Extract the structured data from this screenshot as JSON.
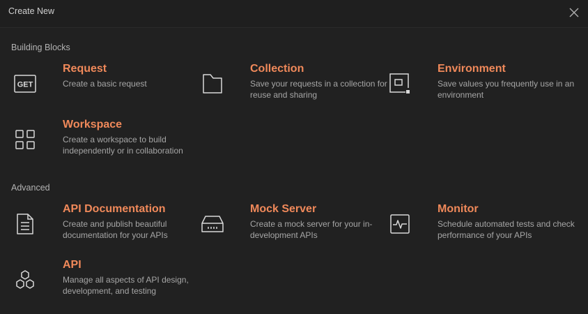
{
  "header": {
    "title": "Create New",
    "close_icon": "close-icon"
  },
  "sections": {
    "building_blocks": {
      "title": "Building Blocks",
      "items": [
        {
          "title": "Request",
          "description": "Create a basic request",
          "icon": "get-request-icon"
        },
        {
          "title": "Collection",
          "description": "Save your requests in a collection for reuse and sharing",
          "icon": "folder-icon"
        },
        {
          "title": "Environment",
          "description": "Save values you frequently use in an environment",
          "icon": "environment-icon"
        },
        {
          "title": "Workspace",
          "description": "Create a workspace to build independently or in collaboration",
          "icon": "grid-icon"
        }
      ]
    },
    "advanced": {
      "title": "Advanced",
      "items": [
        {
          "title": "API Documentation",
          "description": "Create and publish beautiful documentation for your APIs",
          "icon": "document-icon"
        },
        {
          "title": "Mock Server",
          "description": "Create a mock server for your in-development APIs",
          "icon": "server-icon"
        },
        {
          "title": "Monitor",
          "description": "Schedule automated tests and check performance of your APIs",
          "icon": "monitor-icon"
        },
        {
          "title": "API",
          "description": "Manage all aspects of API design, development, and testing",
          "icon": "api-hexagons-icon"
        }
      ]
    }
  },
  "colors": {
    "accent": "#f0895a",
    "background": "#212121",
    "text_muted": "#a6a6a6"
  }
}
